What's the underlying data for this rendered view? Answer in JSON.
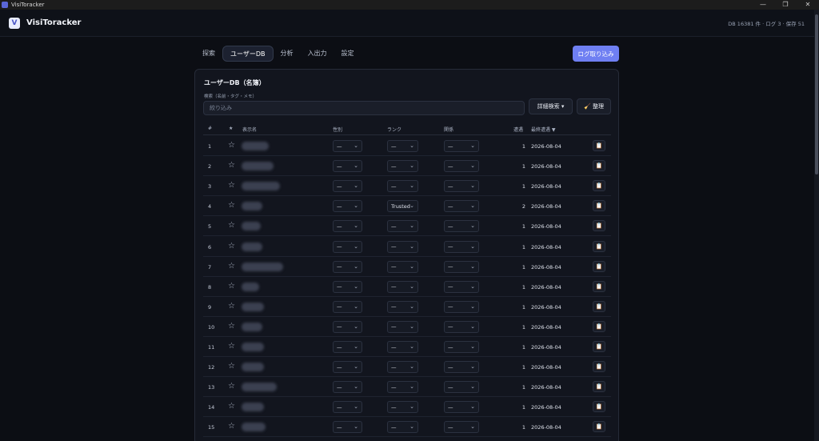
{
  "window": {
    "title": "VisiToracker",
    "minimize": "—",
    "maximize": "❐",
    "close": "✕"
  },
  "app": {
    "logo": "V",
    "name": "VisiToracker",
    "db_info": "DB 16381 件 · ログ 3 · 保存 51"
  },
  "tabs": [
    {
      "label": "探索",
      "active": false
    },
    {
      "label": "ユーザーDB",
      "active": true
    },
    {
      "label": "分析",
      "active": false
    },
    {
      "label": "入出力",
      "active": false
    },
    {
      "label": "設定",
      "active": false
    }
  ],
  "import_button": "ログ取り込み",
  "card": {
    "title": "ユーザーDB（名簿）",
    "search_label": "検索（名前・タグ・メモ）",
    "search_placeholder": "絞り込み",
    "search_value": "",
    "advanced_search": "詳細検索 ▾",
    "tidy": "🧹 整理"
  },
  "columns": {
    "num": "#",
    "star": "★",
    "name": "表示名",
    "gender": "性別",
    "rank": "ランク",
    "relation": "関係",
    "visits": "遭遇",
    "last": "最終遭遇 ▼"
  },
  "rows": [
    {
      "num": "1",
      "star": "☆",
      "gender": "—",
      "rank": "—",
      "relation": "—",
      "visits": "1",
      "last": "2026-08-04",
      "memo": "📋"
    },
    {
      "num": "2",
      "star": "☆",
      "gender": "—",
      "rank": "—",
      "relation": "—",
      "visits": "1",
      "last": "2026-08-04",
      "memo": "📋"
    },
    {
      "num": "3",
      "star": "☆",
      "gender": "—",
      "rank": "—",
      "relation": "—",
      "visits": "1",
      "last": "2026-08-04",
      "memo": "📋"
    },
    {
      "num": "4",
      "star": "☆",
      "gender": "—",
      "rank": "Trusted",
      "relation": "—",
      "visits": "2",
      "last": "2026-08-04",
      "memo": "📋"
    },
    {
      "num": "5",
      "star": "☆",
      "gender": "—",
      "rank": "—",
      "relation": "—",
      "visits": "1",
      "last": "2026-08-04",
      "memo": "📋"
    },
    {
      "num": "6",
      "star": "☆",
      "gender": "—",
      "rank": "—",
      "relation": "—",
      "visits": "1",
      "last": "2026-08-04",
      "memo": "📋"
    },
    {
      "num": "7",
      "star": "☆",
      "gender": "—",
      "rank": "—",
      "relation": "—",
      "visits": "1",
      "last": "2026-08-04",
      "memo": "📋"
    },
    {
      "num": "8",
      "star": "☆",
      "gender": "—",
      "rank": "—",
      "relation": "—",
      "visits": "1",
      "last": "2026-08-04",
      "memo": "📋"
    },
    {
      "num": "9",
      "star": "☆",
      "gender": "—",
      "rank": "—",
      "relation": "—",
      "visits": "1",
      "last": "2026-08-04",
      "memo": "📋"
    },
    {
      "num": "10",
      "star": "☆",
      "gender": "—",
      "rank": "—",
      "relation": "—",
      "visits": "1",
      "last": "2026-08-04",
      "memo": "📋"
    },
    {
      "num": "11",
      "star": "☆",
      "gender": "—",
      "rank": "—",
      "relation": "—",
      "visits": "1",
      "last": "2026-08-04",
      "memo": "📋"
    },
    {
      "num": "12",
      "star": "☆",
      "gender": "—",
      "rank": "—",
      "relation": "—",
      "visits": "1",
      "last": "2026-08-04",
      "memo": "📋"
    },
    {
      "num": "13",
      "star": "☆",
      "gender": "—",
      "rank": "—",
      "relation": "—",
      "visits": "1",
      "last": "2026-08-04",
      "memo": "📋"
    },
    {
      "num": "14",
      "star": "☆",
      "gender": "—",
      "rank": "—",
      "relation": "—",
      "visits": "1",
      "last": "2026-08-04",
      "memo": "📋"
    },
    {
      "num": "15",
      "star": "☆",
      "gender": "—",
      "rank": "—",
      "relation": "—",
      "visits": "1",
      "last": "2026-08-04",
      "memo": "📋"
    }
  ],
  "colors": {
    "accent": "#6f7ff2",
    "background": "#0c0e14",
    "card": "#12151e"
  }
}
